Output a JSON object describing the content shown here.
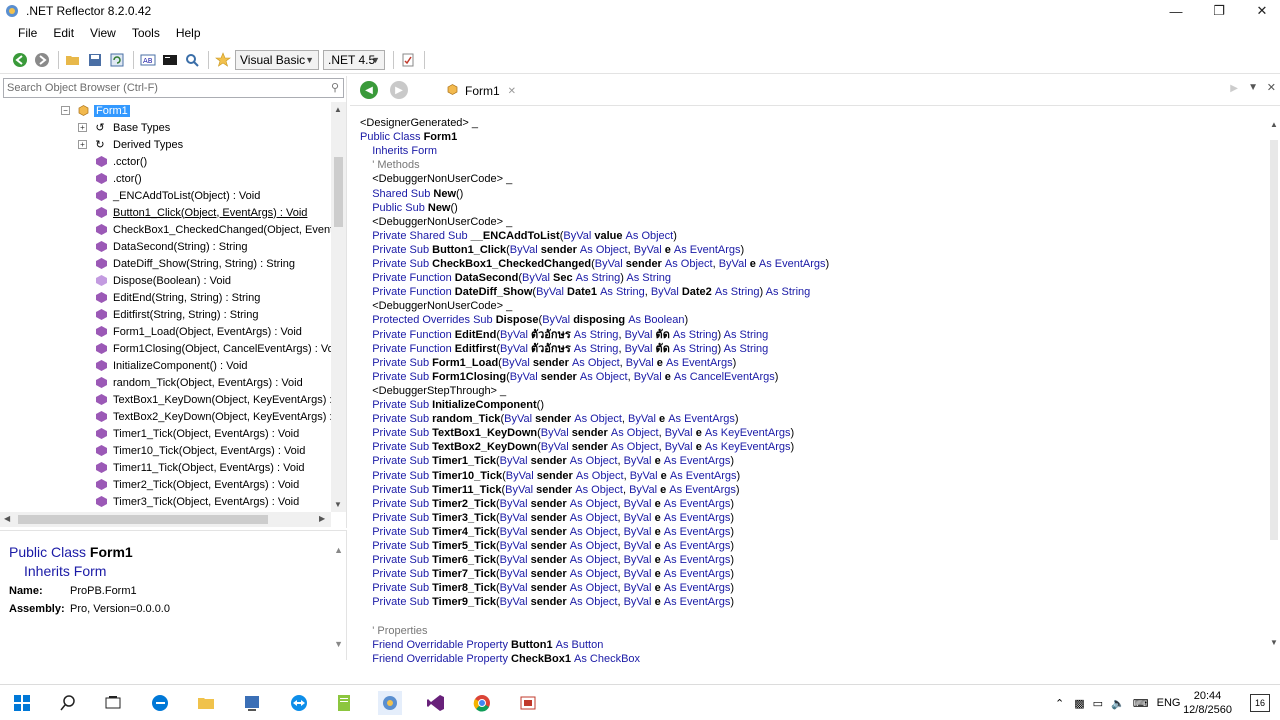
{
  "window": {
    "title": ".NET Reflector 8.2.0.42"
  },
  "menu": [
    "File",
    "Edit",
    "View",
    "Tools",
    "Help"
  ],
  "toolbar": {
    "language": "Visual Basic",
    "framework": ".NET 4.5"
  },
  "search": {
    "placeholder": "Search Object Browser (Ctrl-F)"
  },
  "tree": [
    "Form1",
    "Base Types",
    "Derived Types",
    ".cctor()",
    ".ctor()",
    "_ENCAddToList(Object) : Void",
    "Button1_Click(Object, EventArgs) : Void",
    "CheckBox1_CheckedChanged(Object, Event",
    "DataSecond(String) : String",
    "DateDiff_Show(String, String) : String",
    "Dispose(Boolean) : Void",
    "EditEnd(String, String) : String",
    "Editfirst(String, String) : String",
    "Form1_Load(Object, EventArgs) : Void",
    "Form1Closing(Object, CancelEventArgs) : Vo",
    "InitializeComponent() : Void",
    "random_Tick(Object, EventArgs) : Void",
    "TextBox1_KeyDown(Object, KeyEventArgs) :",
    "TextBox2_KeyDown(Object, KeyEventArgs) :",
    "Timer1_Tick(Object, EventArgs) : Void",
    "Timer10_Tick(Object, EventArgs) : Void",
    "Timer11_Tick(Object, EventArgs) : Void",
    "Timer2_Tick(Object, EventArgs) : Void",
    "Timer3_Tick(Object, EventArgs) : Void"
  ],
  "detail": {
    "decl_kw": "Public Class",
    "decl_name": "Form1",
    "inherits": "Inherits Form",
    "name_label": "Name:",
    "name_value": "ProPB.Form1",
    "assembly_label": "Assembly:",
    "assembly_value": "Pro, Version=0.0.0.0"
  },
  "tab": {
    "label": "Form1"
  },
  "code": [
    [
      [
        "a",
        "<DesignerGenerated> _"
      ]
    ],
    [
      [
        "k",
        "Public Class "
      ],
      [
        "n",
        "Form1"
      ]
    ],
    [
      [
        "k",
        "    Inherits "
      ],
      [
        "k",
        "Form"
      ]
    ],
    [
      [
        "c",
        "    ' Methods"
      ]
    ],
    [
      [
        "a",
        "    <DebuggerNonUserCode> _"
      ]
    ],
    [
      [
        "k",
        "    Shared Sub "
      ],
      [
        "n",
        "New"
      ],
      [
        "t",
        "()"
      ]
    ],
    [
      [
        "k",
        "    Public Sub "
      ],
      [
        "n",
        "New"
      ],
      [
        "t",
        "()"
      ]
    ],
    [
      [
        "a",
        "    <DebuggerNonUserCode> _"
      ]
    ],
    [
      [
        "k",
        "    Private Shared Sub "
      ],
      [
        "n",
        "__ENCAddToList"
      ],
      [
        "t",
        "("
      ],
      [
        "k",
        "ByVal "
      ],
      [
        "n",
        "value "
      ],
      [
        "k",
        "As Object"
      ],
      [
        "t",
        ")"
      ]
    ],
    [
      [
        "k",
        "    Private Sub "
      ],
      [
        "n",
        "Button1_Click"
      ],
      [
        "t",
        "("
      ],
      [
        "k",
        "ByVal "
      ],
      [
        "n",
        "sender "
      ],
      [
        "k",
        "As Object"
      ],
      [
        "t",
        ", "
      ],
      [
        "k",
        "ByVal "
      ],
      [
        "n",
        "e "
      ],
      [
        "k",
        "As EventArgs"
      ],
      [
        "t",
        ")"
      ]
    ],
    [
      [
        "k",
        "    Private Sub "
      ],
      [
        "n",
        "CheckBox1_CheckedChanged"
      ],
      [
        "t",
        "("
      ],
      [
        "k",
        "ByVal "
      ],
      [
        "n",
        "sender "
      ],
      [
        "k",
        "As Object"
      ],
      [
        "t",
        ", "
      ],
      [
        "k",
        "ByVal "
      ],
      [
        "n",
        "e "
      ],
      [
        "k",
        "As EventArgs"
      ],
      [
        "t",
        ")"
      ]
    ],
    [
      [
        "k",
        "    Private Function "
      ],
      [
        "n",
        "DataSecond"
      ],
      [
        "t",
        "("
      ],
      [
        "k",
        "ByVal "
      ],
      [
        "n",
        "Sec "
      ],
      [
        "k",
        "As String"
      ],
      [
        "t",
        ") "
      ],
      [
        "k",
        "As String"
      ]
    ],
    [
      [
        "k",
        "    Private Function "
      ],
      [
        "n",
        "DateDiff_Show"
      ],
      [
        "t",
        "("
      ],
      [
        "k",
        "ByVal "
      ],
      [
        "n",
        "Date1 "
      ],
      [
        "k",
        "As String"
      ],
      [
        "t",
        ", "
      ],
      [
        "k",
        "ByVal "
      ],
      [
        "n",
        "Date2 "
      ],
      [
        "k",
        "As String"
      ],
      [
        "t",
        ") "
      ],
      [
        "k",
        "As String"
      ]
    ],
    [
      [
        "a",
        "    <DebuggerNonUserCode> _"
      ]
    ],
    [
      [
        "k",
        "    Protected Overrides Sub "
      ],
      [
        "n",
        "Dispose"
      ],
      [
        "t",
        "("
      ],
      [
        "k",
        "ByVal "
      ],
      [
        "n",
        "disposing "
      ],
      [
        "k",
        "As Boolean"
      ],
      [
        "t",
        ")"
      ]
    ],
    [
      [
        "k",
        "    Private Function "
      ],
      [
        "n",
        "EditEnd"
      ],
      [
        "t",
        "("
      ],
      [
        "k",
        "ByVal "
      ],
      [
        "n",
        "ตัวอักษร "
      ],
      [
        "k",
        "As String"
      ],
      [
        "t",
        ", "
      ],
      [
        "k",
        "ByVal "
      ],
      [
        "n",
        "ตัด "
      ],
      [
        "k",
        "As String"
      ],
      [
        "t",
        ") "
      ],
      [
        "k",
        "As String"
      ]
    ],
    [
      [
        "k",
        "    Private Function "
      ],
      [
        "n",
        "Editfirst"
      ],
      [
        "t",
        "("
      ],
      [
        "k",
        "ByVal "
      ],
      [
        "n",
        "ตัวอักษร "
      ],
      [
        "k",
        "As String"
      ],
      [
        "t",
        ", "
      ],
      [
        "k",
        "ByVal "
      ],
      [
        "n",
        "ตัด "
      ],
      [
        "k",
        "As String"
      ],
      [
        "t",
        ") "
      ],
      [
        "k",
        "As String"
      ]
    ],
    [
      [
        "k",
        "    Private Sub "
      ],
      [
        "n",
        "Form1_Load"
      ],
      [
        "t",
        "("
      ],
      [
        "k",
        "ByVal "
      ],
      [
        "n",
        "sender "
      ],
      [
        "k",
        "As Object"
      ],
      [
        "t",
        ", "
      ],
      [
        "k",
        "ByVal "
      ],
      [
        "n",
        "e "
      ],
      [
        "k",
        "As EventArgs"
      ],
      [
        "t",
        ")"
      ]
    ],
    [
      [
        "k",
        "    Private Sub "
      ],
      [
        "n",
        "Form1Closing"
      ],
      [
        "t",
        "("
      ],
      [
        "k",
        "ByVal "
      ],
      [
        "n",
        "sender "
      ],
      [
        "k",
        "As Object"
      ],
      [
        "t",
        ", "
      ],
      [
        "k",
        "ByVal "
      ],
      [
        "n",
        "e "
      ],
      [
        "k",
        "As CancelEventArgs"
      ],
      [
        "t",
        ")"
      ]
    ],
    [
      [
        "a",
        "    <DebuggerStepThrough> _"
      ]
    ],
    [
      [
        "k",
        "    Private Sub "
      ],
      [
        "n",
        "InitializeComponent"
      ],
      [
        "t",
        "()"
      ]
    ],
    [
      [
        "k",
        "    Private Sub "
      ],
      [
        "n",
        "random_Tick"
      ],
      [
        "t",
        "("
      ],
      [
        "k",
        "ByVal "
      ],
      [
        "n",
        "sender "
      ],
      [
        "k",
        "As Object"
      ],
      [
        "t",
        ", "
      ],
      [
        "k",
        "ByVal "
      ],
      [
        "n",
        "e "
      ],
      [
        "k",
        "As EventArgs"
      ],
      [
        "t",
        ")"
      ]
    ],
    [
      [
        "k",
        "    Private Sub "
      ],
      [
        "n",
        "TextBox1_KeyDown"
      ],
      [
        "t",
        "("
      ],
      [
        "k",
        "ByVal "
      ],
      [
        "n",
        "sender "
      ],
      [
        "k",
        "As Object"
      ],
      [
        "t",
        ", "
      ],
      [
        "k",
        "ByVal "
      ],
      [
        "n",
        "e "
      ],
      [
        "k",
        "As KeyEventArgs"
      ],
      [
        "t",
        ")"
      ]
    ],
    [
      [
        "k",
        "    Private Sub "
      ],
      [
        "n",
        "TextBox2_KeyDown"
      ],
      [
        "t",
        "("
      ],
      [
        "k",
        "ByVal "
      ],
      [
        "n",
        "sender "
      ],
      [
        "k",
        "As Object"
      ],
      [
        "t",
        ", "
      ],
      [
        "k",
        "ByVal "
      ],
      [
        "n",
        "e "
      ],
      [
        "k",
        "As KeyEventArgs"
      ],
      [
        "t",
        ")"
      ]
    ],
    [
      [
        "k",
        "    Private Sub "
      ],
      [
        "n",
        "Timer1_Tick"
      ],
      [
        "t",
        "("
      ],
      [
        "k",
        "ByVal "
      ],
      [
        "n",
        "sender "
      ],
      [
        "k",
        "As Object"
      ],
      [
        "t",
        ", "
      ],
      [
        "k",
        "ByVal "
      ],
      [
        "n",
        "e "
      ],
      [
        "k",
        "As EventArgs"
      ],
      [
        "t",
        ")"
      ]
    ],
    [
      [
        "k",
        "    Private Sub "
      ],
      [
        "n",
        "Timer10_Tick"
      ],
      [
        "t",
        "("
      ],
      [
        "k",
        "ByVal "
      ],
      [
        "n",
        "sender "
      ],
      [
        "k",
        "As Object"
      ],
      [
        "t",
        ", "
      ],
      [
        "k",
        "ByVal "
      ],
      [
        "n",
        "e "
      ],
      [
        "k",
        "As EventArgs"
      ],
      [
        "t",
        ")"
      ]
    ],
    [
      [
        "k",
        "    Private Sub "
      ],
      [
        "n",
        "Timer11_Tick"
      ],
      [
        "t",
        "("
      ],
      [
        "k",
        "ByVal "
      ],
      [
        "n",
        "sender "
      ],
      [
        "k",
        "As Object"
      ],
      [
        "t",
        ", "
      ],
      [
        "k",
        "ByVal "
      ],
      [
        "n",
        "e "
      ],
      [
        "k",
        "As EventArgs"
      ],
      [
        "t",
        ")"
      ]
    ],
    [
      [
        "k",
        "    Private Sub "
      ],
      [
        "n",
        "Timer2_Tick"
      ],
      [
        "t",
        "("
      ],
      [
        "k",
        "ByVal "
      ],
      [
        "n",
        "sender "
      ],
      [
        "k",
        "As Object"
      ],
      [
        "t",
        ", "
      ],
      [
        "k",
        "ByVal "
      ],
      [
        "n",
        "e "
      ],
      [
        "k",
        "As EventArgs"
      ],
      [
        "t",
        ")"
      ]
    ],
    [
      [
        "k",
        "    Private Sub "
      ],
      [
        "n",
        "Timer3_Tick"
      ],
      [
        "t",
        "("
      ],
      [
        "k",
        "ByVal "
      ],
      [
        "n",
        "sender "
      ],
      [
        "k",
        "As Object"
      ],
      [
        "t",
        ", "
      ],
      [
        "k",
        "ByVal "
      ],
      [
        "n",
        "e "
      ],
      [
        "k",
        "As EventArgs"
      ],
      [
        "t",
        ")"
      ]
    ],
    [
      [
        "k",
        "    Private Sub "
      ],
      [
        "n",
        "Timer4_Tick"
      ],
      [
        "t",
        "("
      ],
      [
        "k",
        "ByVal "
      ],
      [
        "n",
        "sender "
      ],
      [
        "k",
        "As Object"
      ],
      [
        "t",
        ", "
      ],
      [
        "k",
        "ByVal "
      ],
      [
        "n",
        "e "
      ],
      [
        "k",
        "As EventArgs"
      ],
      [
        "t",
        ")"
      ]
    ],
    [
      [
        "k",
        "    Private Sub "
      ],
      [
        "n",
        "Timer5_Tick"
      ],
      [
        "t",
        "("
      ],
      [
        "k",
        "ByVal "
      ],
      [
        "n",
        "sender "
      ],
      [
        "k",
        "As Object"
      ],
      [
        "t",
        ", "
      ],
      [
        "k",
        "ByVal "
      ],
      [
        "n",
        "e "
      ],
      [
        "k",
        "As EventArgs"
      ],
      [
        "t",
        ")"
      ]
    ],
    [
      [
        "k",
        "    Private Sub "
      ],
      [
        "n",
        "Timer6_Tick"
      ],
      [
        "t",
        "("
      ],
      [
        "k",
        "ByVal "
      ],
      [
        "n",
        "sender "
      ],
      [
        "k",
        "As Object"
      ],
      [
        "t",
        ", "
      ],
      [
        "k",
        "ByVal "
      ],
      [
        "n",
        "e "
      ],
      [
        "k",
        "As EventArgs"
      ],
      [
        "t",
        ")"
      ]
    ],
    [
      [
        "k",
        "    Private Sub "
      ],
      [
        "n",
        "Timer7_Tick"
      ],
      [
        "t",
        "("
      ],
      [
        "k",
        "ByVal "
      ],
      [
        "n",
        "sender "
      ],
      [
        "k",
        "As Object"
      ],
      [
        "t",
        ", "
      ],
      [
        "k",
        "ByVal "
      ],
      [
        "n",
        "e "
      ],
      [
        "k",
        "As EventArgs"
      ],
      [
        "t",
        ")"
      ]
    ],
    [
      [
        "k",
        "    Private Sub "
      ],
      [
        "n",
        "Timer8_Tick"
      ],
      [
        "t",
        "("
      ],
      [
        "k",
        "ByVal "
      ],
      [
        "n",
        "sender "
      ],
      [
        "k",
        "As Object"
      ],
      [
        "t",
        ", "
      ],
      [
        "k",
        "ByVal "
      ],
      [
        "n",
        "e "
      ],
      [
        "k",
        "As EventArgs"
      ],
      [
        "t",
        ")"
      ]
    ],
    [
      [
        "k",
        "    Private Sub "
      ],
      [
        "n",
        "Timer9_Tick"
      ],
      [
        "t",
        "("
      ],
      [
        "k",
        "ByVal "
      ],
      [
        "n",
        "sender "
      ],
      [
        "k",
        "As Object"
      ],
      [
        "t",
        ", "
      ],
      [
        "k",
        "ByVal "
      ],
      [
        "n",
        "e "
      ],
      [
        "k",
        "As EventArgs"
      ],
      [
        "t",
        ")"
      ]
    ],
    [
      [
        "t",
        ""
      ]
    ],
    [
      [
        "c",
        "    ' Properties"
      ]
    ],
    [
      [
        "k",
        "    Friend Overridable Property "
      ],
      [
        "n",
        "Button1 "
      ],
      [
        "k",
        "As Button"
      ]
    ],
    [
      [
        "k",
        "    Friend Overridable Property "
      ],
      [
        "n",
        "CheckBox1 "
      ],
      [
        "k",
        "As CheckBox"
      ]
    ]
  ],
  "taskbar": {
    "language": "ENG",
    "time": "20:44",
    "date": "12/8/2560",
    "notif_count": "16"
  },
  "colors": {
    "keyword": "#1a1aa6",
    "selection": "#3399ff",
    "comment": "#777777"
  }
}
